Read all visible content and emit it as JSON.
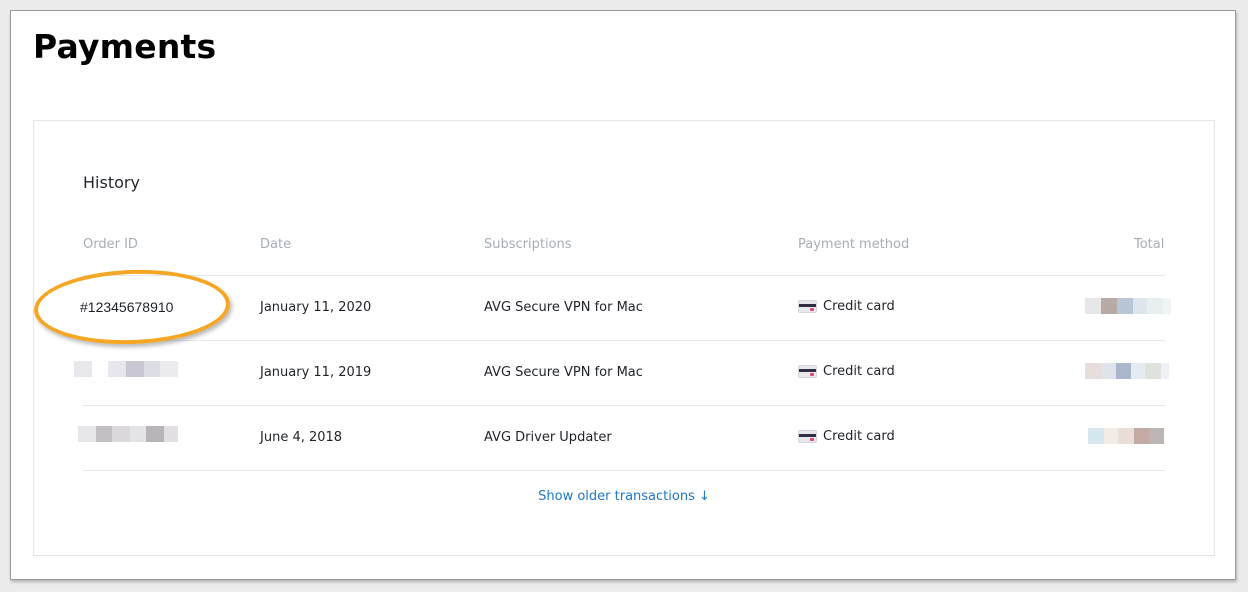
{
  "page": {
    "title": "Payments"
  },
  "history": {
    "heading": "History",
    "columns": {
      "order_id": "Order ID",
      "date": "Date",
      "subscriptions": "Subscriptions",
      "payment_method": "Payment method",
      "total": "Total"
    },
    "rows": [
      {
        "order_id": "#12345678910",
        "date": "January 11, 2020",
        "subscription": "AVG Secure VPN for Mac",
        "payment_method": "Credit card"
      },
      {
        "order_id": "",
        "date": "January 11, 2019",
        "subscription": "AVG Secure VPN for Mac",
        "payment_method": "Credit card"
      },
      {
        "order_id": "",
        "date": "June 4, 2018",
        "subscription": "AVG Driver Updater",
        "payment_method": "Credit card"
      }
    ],
    "show_older": "Show older transactions ↓"
  },
  "icons": {
    "payment": "credit-card-icon"
  },
  "colors": {
    "link": "#1f78c8",
    "highlight": "#f5a623",
    "header_text": "#a7adb6"
  }
}
